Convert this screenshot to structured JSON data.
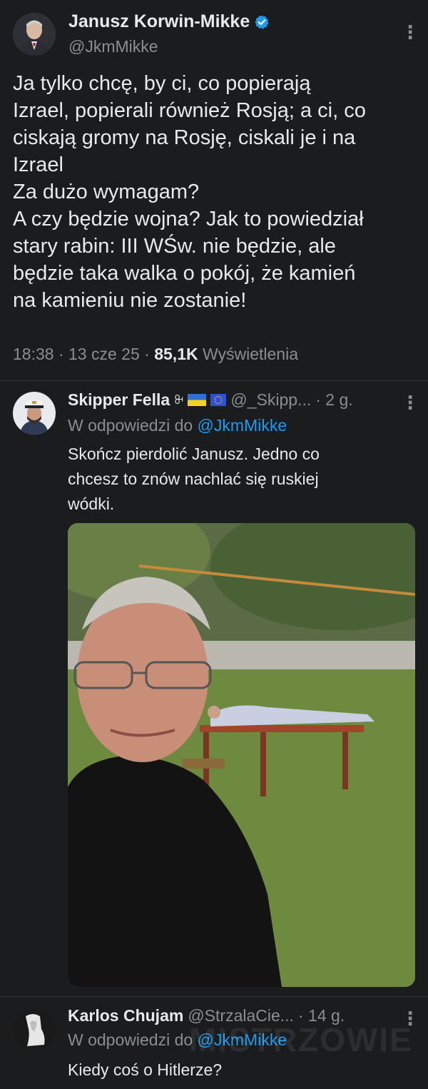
{
  "main_tweet": {
    "author_name": "Janusz Korwin-Mikke",
    "author_handle": "@JkmMikke",
    "text": "Ja tylko chcę, by ci, co popierają\nIzrael, popierali również Rosją; a ci, co\nciskają gromy na Rosję, ciskali je i na\nIzrael\nZa dużo wymagam?\nA czy będzie wojna? Jak to powiedział\nstary rabin: III WŚw.  nie będzie, ale\nbędzie taka walka o pokój, że kamień\nna kamieniu nie zostanie!",
    "time": "18:38",
    "date": "13 cze 25",
    "views_count": "85,1K",
    "views_label": "Wyświetlenia",
    "separator": "·",
    "icons": {
      "verified": "verified-badge-icon",
      "more": "more-options-icon"
    }
  },
  "replies": [
    {
      "author_name": "Skipper Fella",
      "author_handle": "@_Skipp...",
      "time": "· 2 g.",
      "reply_prefix": "W odpowiedzi do",
      "reply_mention": "@JkmMikke",
      "text": "Skończ pierdolić Janusz. Jedno co\nchcesz to znów nachlać się ruskiej\nwódki.",
      "flag_symbol": "ꔬ",
      "flags": [
        "ukraine-flag",
        "eu-flag"
      ]
    },
    {
      "author_name": "Karlos Chujam",
      "author_handle": "@StrzalaCie...",
      "time": "· 14 g.",
      "reply_prefix": "W odpowiedzi do",
      "reply_mention": "@JkmMikke",
      "text": "Kiedy coś o Hitlerze?"
    }
  ],
  "watermark": "MISTRZOWIE",
  "colors": {
    "background": "#1b1c1e",
    "text": "#e7e9ea",
    "muted": "#8a8d91",
    "link": "#1d9bf0",
    "verified": "#1d9bf0"
  }
}
